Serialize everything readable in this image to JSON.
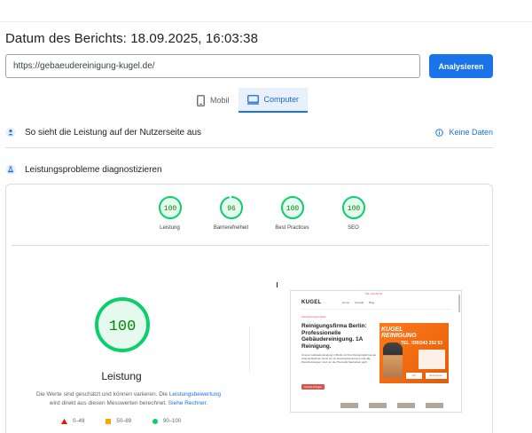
{
  "report": {
    "date_label": "Datum des Berichts: 18.09.2025, 16:03:38"
  },
  "search": {
    "url_value": "https://gebaeudereinigung-kugel.de/",
    "analyze_label": "Analysieren"
  },
  "device_tabs": [
    {
      "label": "Mobil",
      "icon": "phone-icon",
      "active": false
    },
    {
      "label": "Computer",
      "icon": "desktop-icon",
      "active": true
    }
  ],
  "field_data": {
    "title": "So sieht die Leistung auf der Nutzerseite aus",
    "no_data_label": "Keine Daten"
  },
  "diagnose": {
    "title": "Leistungsprobleme diagnostizieren"
  },
  "scores": [
    {
      "label": "Leistung",
      "score": "100",
      "value": 100
    },
    {
      "label": "Barrierefreiheit",
      "score": "96",
      "value": 96
    },
    {
      "label": "Best Practices",
      "score": "100",
      "value": 100
    },
    {
      "label": "SEO",
      "score": "100",
      "value": 100
    }
  ],
  "performance": {
    "score": "100",
    "value": 100,
    "label": "Leistung",
    "disclaimer_text": "Die Werte sind geschätzt und können variieren. Die",
    "disclaimer_link1": "Leistungsbewertung",
    "disclaimer_text2": "wird direkt aus diesen Messwerten berechnet.",
    "disclaimer_link2": "Siehe Rechner."
  },
  "legend": [
    {
      "range": "0–49",
      "shape": "triangle",
      "color": "#eb0f00"
    },
    {
      "range": "50–89",
      "shape": "square",
      "color": "#ffa400"
    },
    {
      "range": "90–100",
      "shape": "circle",
      "color": "#0cce6b"
    }
  ],
  "colors": {
    "pass": "#0cce6b",
    "pass_text": "#008800",
    "pass_bg": "#e6f9ee",
    "accent": "#1a73e8"
  },
  "screenshot": {
    "logo": "KUGEL",
    "nav": [
      "Home",
      "Kontakt",
      "Blog"
    ],
    "top_contact": "030 / 243 252 53",
    "small_label": "Gebäudereinigung Berlin",
    "headline": "Reinigungsfirma Berlin: Professionelle Gebäudereinigung. 1A Reinigung.",
    "body": "Unsere Gebäudereinigung in Berlin ist Ihre Reinigungsfirma als Ansprechpartner wenn es um Hausmeisterservice und alle Dienstleistungen rund um die Thematik Sauberkeit geht.",
    "cta": "Angebot anfragen",
    "banner_title": "KUGEL\nREINIGUNG",
    "banner_phone": "TEL. 030/243 252 53",
    "banner_chips": [
      "24/7",
      "Bewertungen"
    ]
  }
}
